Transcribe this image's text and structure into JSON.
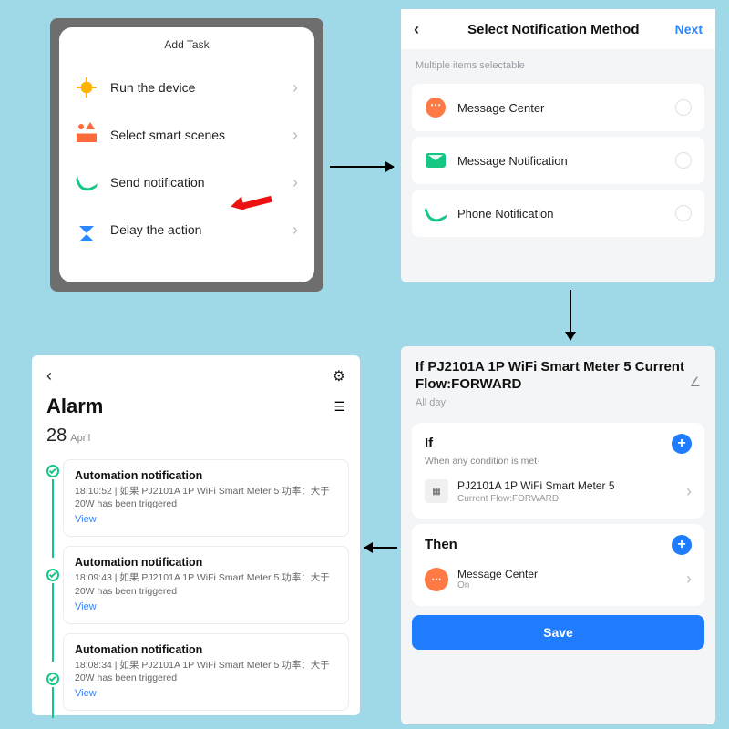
{
  "p1": {
    "title": "Add Task",
    "items": [
      {
        "label": "Run the device",
        "icon": "sun-icon"
      },
      {
        "label": "Select smart scenes",
        "icon": "scene-icon"
      },
      {
        "label": "Send notification",
        "icon": "phone-notify-icon"
      },
      {
        "label": "Delay the action",
        "icon": "hourglass-icon"
      }
    ]
  },
  "p2": {
    "title": "Select Notification Method",
    "next": "Next",
    "subtitle": "Multiple items selectable",
    "items": [
      {
        "label": "Message Center",
        "icon": "message-center-icon"
      },
      {
        "label": "Message Notification",
        "icon": "mail-icon"
      },
      {
        "label": "Phone Notification",
        "icon": "call-icon"
      }
    ]
  },
  "p3": {
    "title": "If PJ2101A 1P WiFi Smart Meter  5 Current Flow:FORWARD",
    "subtitle": "All day",
    "if_label": "If",
    "if_sub": "When any condition is met·",
    "device_name": "PJ2101A 1P WiFi Smart Meter 5",
    "device_state": "Current Flow:FORWARD",
    "then_label": "Then",
    "then_name": "Message Center",
    "then_state": "On",
    "save": "Save"
  },
  "p4": {
    "title": "Alarm",
    "day": "28",
    "month": "April",
    "items": [
      {
        "title": "Automation notification",
        "body": "18:10:52 | 如果 PJ2101A 1P WiFi Smart Meter  5 功率：大于20W has been triggered",
        "view": "View"
      },
      {
        "title": "Automation notification",
        "body": "18:09:43 | 如果 PJ2101A 1P WiFi Smart Meter  5 功率：大于20W has been triggered",
        "view": "View"
      },
      {
        "title": "Automation notification",
        "body": "18:08:34 | 如果 PJ2101A 1P WiFi Smart Meter  5 功率：大于20W has been triggered",
        "view": "View"
      }
    ]
  }
}
